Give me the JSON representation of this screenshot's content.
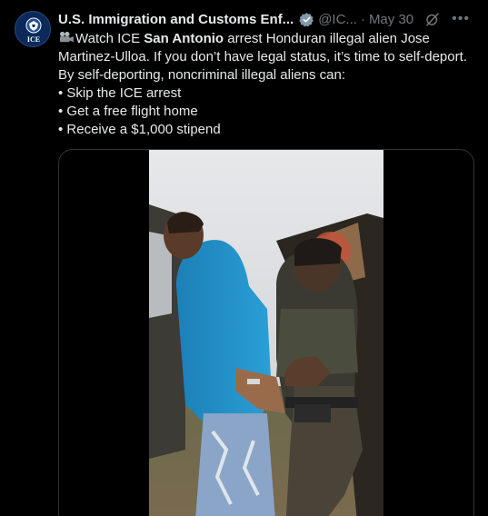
{
  "author": {
    "display_name": "U.S. Immigration and Customs Enf...",
    "handle": "@IC...",
    "separator": "·",
    "date": "May 30",
    "avatar_label": "ICE"
  },
  "tweet": {
    "line1_pre": "Watch ICE ",
    "line1_bold": "San Antonio",
    "line1_post": " arrest Honduran illegal alien Jose Martinez-Ulloa.  If you don’t have legal status, it’s time to self-deport. By self-deporting, noncriminal illegal aliens can:",
    "bullets": [
      "• Skip the ICE arrest",
      "• Get a free flight home",
      "• Receive a $1,000 stipend"
    ]
  },
  "icons": {
    "verified": "verified-badge-icon",
    "grok": "grok-icon",
    "more": "more-options-icon",
    "camera": "movie-camera-icon"
  },
  "colors": {
    "background": "#000000",
    "text": "#e7e9ea",
    "muted": "#71767b",
    "avatar_bg": "#0b2a5b"
  }
}
